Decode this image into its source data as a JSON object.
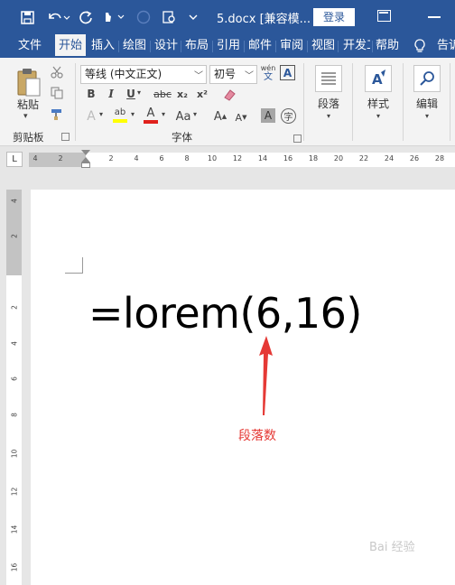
{
  "titlebar": {
    "doc_title": "5.docx [兼容模...",
    "login": "登录"
  },
  "tabs": [
    "文件",
    "开始",
    "插入",
    "绘图",
    "设计",
    "布局",
    "引用",
    "邮件",
    "审阅",
    "视图",
    "开发工",
    "帮助",
    "告诉"
  ],
  "active_tab": "开始",
  "clipboard": {
    "paste_label": "粘贴",
    "group_label": "剪贴板"
  },
  "font": {
    "family": "等线 (中文正文)",
    "size": "初号",
    "group_label": "字体",
    "bold": "B",
    "italic": "I",
    "underline": "U",
    "strike": "abc",
    "subscript": "x₂",
    "superscript": "x²",
    "grow": "A",
    "shrink": "A",
    "case": "Aa",
    "pinyin_top": "wén",
    "pinyin_bottom": "文",
    "highlight_letter": "ab",
    "color_letter": "A",
    "shade_letter": "A",
    "effects_letter": "A",
    "border_letter": "A",
    "enclose_letter": "字"
  },
  "paragraph": {
    "label": "段落"
  },
  "styles": {
    "label": "样式"
  },
  "editing": {
    "label": "编辑"
  },
  "ruler": {
    "corner": "L",
    "ticks": [
      "4",
      "2",
      "2",
      "4",
      "6",
      "8",
      "10",
      "12",
      "14",
      "16",
      "18",
      "20",
      "22",
      "24",
      "26",
      "28"
    ],
    "vticks": [
      "4",
      "2",
      "2",
      "4",
      "6",
      "8",
      "10",
      "12",
      "14",
      "16"
    ]
  },
  "document": {
    "formula": "=lorem(6,16)",
    "annotation": "段落数"
  },
  "watermark": "Bai 经验",
  "colors": {
    "brand": "#2b579a",
    "arrow": "#e53935"
  }
}
